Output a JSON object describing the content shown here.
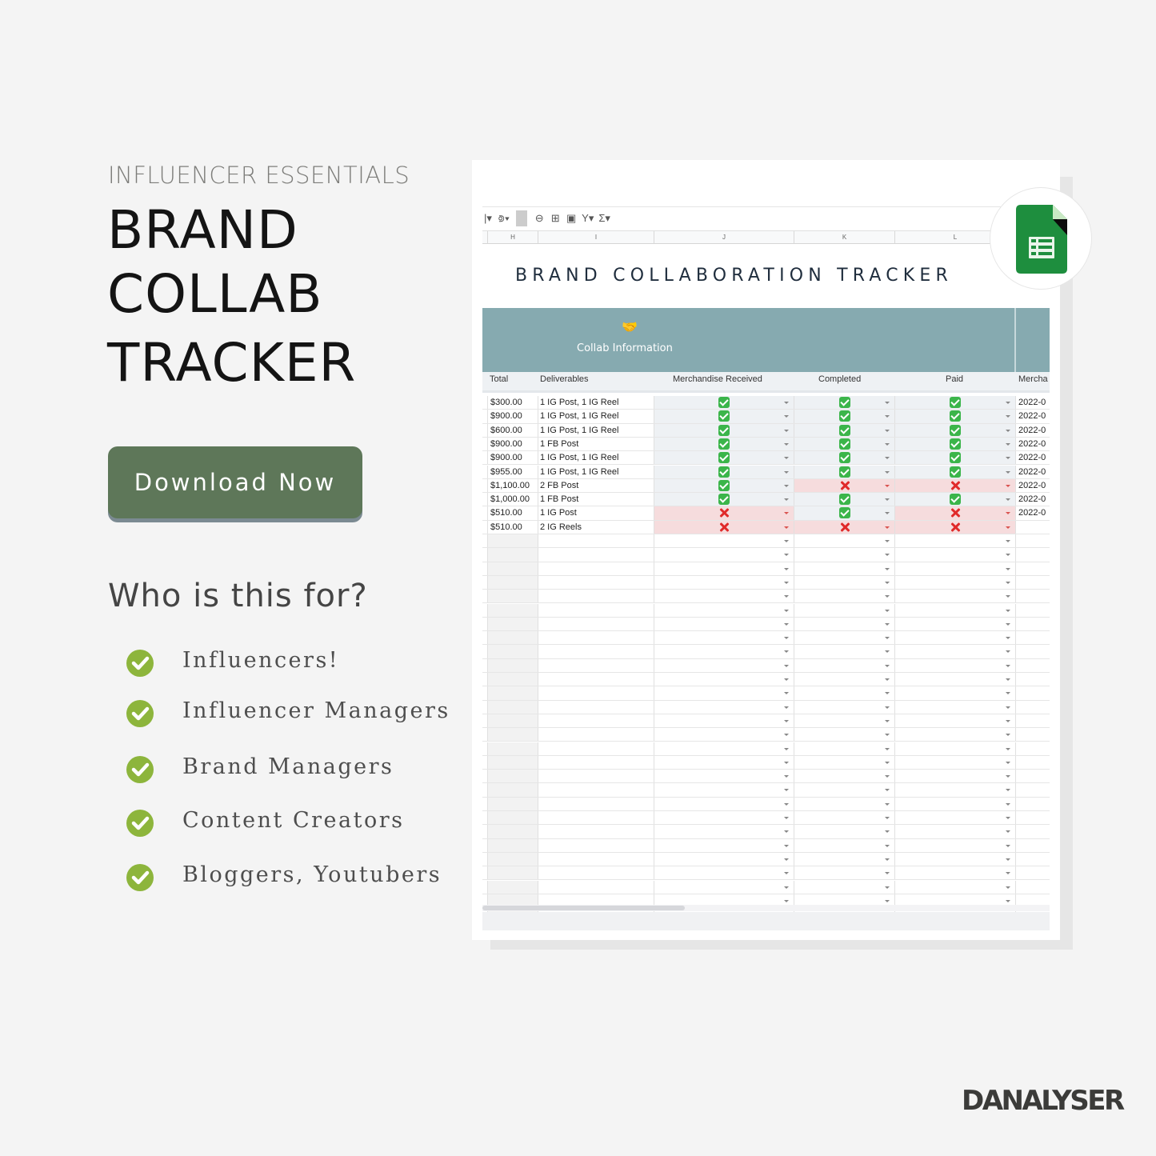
{
  "left": {
    "eyebrow": "INFLUENCER ESSENTIALS",
    "hero_lines": [
      "BRAND",
      "COLLAB",
      "TRACKER"
    ],
    "download_button": "Download Now",
    "who_heading": "Who is this for?",
    "audience": [
      {
        "icon": "check-circle-icon",
        "label": "Influencers!"
      },
      {
        "icon": "check-circle-icon",
        "label": "Influencer Managers"
      },
      {
        "icon": "check-circle-icon",
        "label": "Brand Managers"
      },
      {
        "icon": "check-circle-icon",
        "label": "Content Creators"
      },
      {
        "icon": "check-circle-icon",
        "label": "Bloggers, Youtubers"
      }
    ]
  },
  "brand": "DANALYSER",
  "colors": {
    "background": "#f4f4f4",
    "button": "#5e7759",
    "check_green": "#8db53c",
    "band_teal": "#86aab0",
    "yes_cell": "#eef1f4",
    "no_cell": "#f6dcdd",
    "sheets_green": "#1e8e3e"
  },
  "sheet": {
    "toolbar_icons": [
      "borders-icon",
      "fill-color-icon",
      "link-icon",
      "comment-icon",
      "chart-icon",
      "filter-icon",
      "functions-icon"
    ],
    "toolbar_glyphs": [
      "|▾",
      "⟄▾",
      "⊖",
      "⊞",
      "▣",
      "Y▾",
      "Σ▾"
    ],
    "column_letters": [
      "H",
      "I",
      "J",
      "K",
      "L"
    ],
    "title": "BRAND COLLABORATION TRACKER",
    "section_emoji": "🤝",
    "section_title": "Collab Information",
    "headers": [
      "Total",
      "Deliverables",
      "Merchandise Received",
      "Completed",
      "Paid",
      "Mercha"
    ],
    "rows": [
      {
        "total": "$300.00",
        "deliverables": "1 IG Post, 1 IG Reel",
        "merch": "yes",
        "completed": "yes",
        "paid": "yes",
        "date": "2022-0"
      },
      {
        "total": "$900.00",
        "deliverables": "1 IG Post, 1 IG Reel",
        "merch": "yes",
        "completed": "yes",
        "paid": "yes",
        "date": "2022-0"
      },
      {
        "total": "$600.00",
        "deliverables": "1 IG Post, 1 IG Reel",
        "merch": "yes",
        "completed": "yes",
        "paid": "yes",
        "date": "2022-0"
      },
      {
        "total": "$900.00",
        "deliverables": "1 FB Post",
        "merch": "yes",
        "completed": "yes",
        "paid": "yes",
        "date": "2022-0"
      },
      {
        "total": "$900.00",
        "deliverables": "1 IG Post, 1 IG Reel",
        "merch": "yes",
        "completed": "yes",
        "paid": "yes",
        "date": "2022-0"
      },
      {
        "total": "$955.00",
        "deliverables": "1 IG Post, 1 IG Reel",
        "merch": "yes",
        "completed": "yes",
        "paid": "yes",
        "date": "2022-0"
      },
      {
        "total": "$1,100.00",
        "deliverables": "2 FB Post",
        "merch": "yes",
        "completed": "no",
        "paid": "no",
        "date": "2022-0"
      },
      {
        "total": "$1,000.00",
        "deliverables": "1 FB Post",
        "merch": "yes",
        "completed": "yes",
        "paid": "yes",
        "date": "2022-0"
      },
      {
        "total": "$510.00",
        "deliverables": "1 IG Post",
        "merch": "no",
        "completed": "yes",
        "paid": "no",
        "date": "2022-0"
      },
      {
        "total": "$510.00",
        "deliverables": "2 IG Reels",
        "merch": "no",
        "completed": "no",
        "paid": "no",
        "date": ""
      }
    ],
    "empty_rows": 28
  }
}
